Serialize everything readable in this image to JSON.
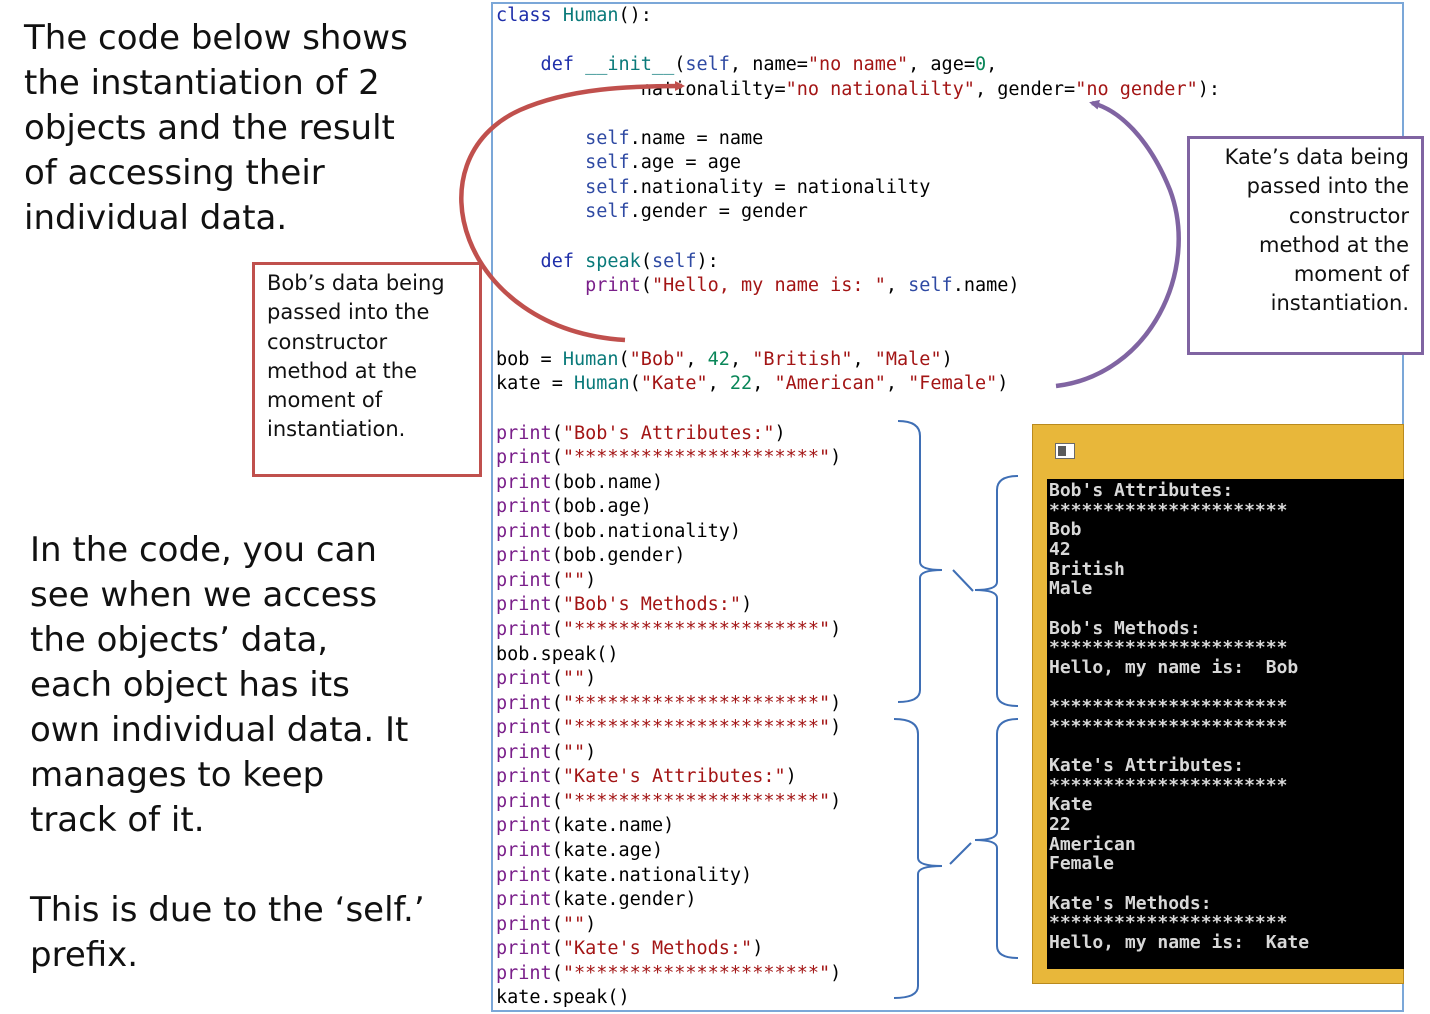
{
  "intro_text": [
    "The code below shows",
    "the instantiation of 2",
    "objects and the result",
    "of accessing their",
    "individual data."
  ],
  "explain_text": [
    "In the code, you can",
    "see when we access",
    "the objects’ data,",
    "each object has its",
    "own individual data. It",
    "manages to keep",
    "track of it."
  ],
  "prefix_text": [
    "This is due to the ‘self.’",
    "prefix."
  ],
  "callouts": {
    "bob": [
      "Bob’s data being",
      "passed into the",
      "constructor",
      "method at the",
      "moment of",
      "instantiation."
    ],
    "kate": [
      "Kate’s data being",
      "passed into the",
      "constructor",
      "method at the",
      "moment of",
      "instantiation."
    ]
  },
  "code": [
    [
      [
        "kw",
        "class "
      ],
      [
        "fn",
        "Human"
      ],
      [
        "pl",
        "():"
      ]
    ],
    [],
    [
      [
        "kw",
        "    def "
      ],
      [
        "fn",
        "__init__"
      ],
      [
        "pl",
        "("
      ],
      [
        "sf",
        "self"
      ],
      [
        "pl",
        ", name="
      ],
      [
        "st",
        "\"no name\""
      ],
      [
        "pl",
        ", age="
      ],
      [
        "nu",
        "0"
      ],
      [
        "pl",
        ","
      ]
    ],
    [
      [
        "pl",
        "             nationalilty="
      ],
      [
        "st",
        "\"no nationalilty\""
      ],
      [
        "pl",
        ", gender="
      ],
      [
        "st",
        "\"no gender\""
      ],
      [
        "pl",
        "):"
      ]
    ],
    [],
    [
      [
        "sf",
        "        self"
      ],
      [
        "pl",
        ".name = name"
      ]
    ],
    [
      [
        "sf",
        "        self"
      ],
      [
        "pl",
        ".age = age"
      ]
    ],
    [
      [
        "sf",
        "        self"
      ],
      [
        "pl",
        ".nationality = nationalilty"
      ]
    ],
    [
      [
        "sf",
        "        self"
      ],
      [
        "pl",
        ".gender = gender"
      ]
    ],
    [],
    [
      [
        "kw",
        "    def "
      ],
      [
        "fn",
        "speak"
      ],
      [
        "pl",
        "("
      ],
      [
        "sf",
        "self"
      ],
      [
        "pl",
        "):"
      ]
    ],
    [
      [
        "bi",
        "        print"
      ],
      [
        "pl",
        "("
      ],
      [
        "st",
        "\"Hello, my name is: \""
      ],
      [
        "pl",
        ", "
      ],
      [
        "sf",
        "self"
      ],
      [
        "pl",
        ".name)"
      ]
    ],
    [],
    [],
    [
      [
        "pl",
        "bob = "
      ],
      [
        "fn",
        "Human"
      ],
      [
        "pl",
        "("
      ],
      [
        "st",
        "\"Bob\""
      ],
      [
        "pl",
        ", "
      ],
      [
        "nu",
        "42"
      ],
      [
        "pl",
        ", "
      ],
      [
        "st",
        "\"British\""
      ],
      [
        "pl",
        ", "
      ],
      [
        "st",
        "\"Male\""
      ],
      [
        "pl",
        ")"
      ]
    ],
    [
      [
        "pl",
        "kate = "
      ],
      [
        "fn",
        "Human"
      ],
      [
        "pl",
        "("
      ],
      [
        "st",
        "\"Kate\""
      ],
      [
        "pl",
        ", "
      ],
      [
        "nu",
        "22"
      ],
      [
        "pl",
        ", "
      ],
      [
        "st",
        "\"American\""
      ],
      [
        "pl",
        ", "
      ],
      [
        "st",
        "\"Female\""
      ],
      [
        "pl",
        ")"
      ]
    ],
    [],
    [
      [
        "bi",
        "print"
      ],
      [
        "pl",
        "("
      ],
      [
        "st",
        "\"Bob's Attributes:\""
      ],
      [
        "pl",
        ")"
      ]
    ],
    [
      [
        "bi",
        "print"
      ],
      [
        "pl",
        "("
      ],
      [
        "st",
        "\"**********************\""
      ],
      [
        "pl",
        ")"
      ]
    ],
    [
      [
        "bi",
        "print"
      ],
      [
        "pl",
        "(bob.name)"
      ]
    ],
    [
      [
        "bi",
        "print"
      ],
      [
        "pl",
        "(bob.age)"
      ]
    ],
    [
      [
        "bi",
        "print"
      ],
      [
        "pl",
        "(bob.nationality)"
      ]
    ],
    [
      [
        "bi",
        "print"
      ],
      [
        "pl",
        "(bob.gender)"
      ]
    ],
    [
      [
        "bi",
        "print"
      ],
      [
        "pl",
        "("
      ],
      [
        "st",
        "\"\""
      ],
      [
        "pl",
        ")"
      ]
    ],
    [
      [
        "bi",
        "print"
      ],
      [
        "pl",
        "("
      ],
      [
        "st",
        "\"Bob's Methods:\""
      ],
      [
        "pl",
        ")"
      ]
    ],
    [
      [
        "bi",
        "print"
      ],
      [
        "pl",
        "("
      ],
      [
        "st",
        "\"**********************\""
      ],
      [
        "pl",
        ")"
      ]
    ],
    [
      [
        "pl",
        "bob.speak()"
      ]
    ],
    [
      [
        "bi",
        "print"
      ],
      [
        "pl",
        "("
      ],
      [
        "st",
        "\"\""
      ],
      [
        "pl",
        ")"
      ]
    ],
    [
      [
        "bi",
        "print"
      ],
      [
        "pl",
        "("
      ],
      [
        "st",
        "\"**********************\""
      ],
      [
        "pl",
        ")"
      ]
    ],
    [
      [
        "bi",
        "print"
      ],
      [
        "pl",
        "("
      ],
      [
        "st",
        "\"**********************\""
      ],
      [
        "pl",
        ")"
      ]
    ],
    [
      [
        "bi",
        "print"
      ],
      [
        "pl",
        "("
      ],
      [
        "st",
        "\"\""
      ],
      [
        "pl",
        ")"
      ]
    ],
    [
      [
        "bi",
        "print"
      ],
      [
        "pl",
        "("
      ],
      [
        "st",
        "\"Kate's Attributes:\""
      ],
      [
        "pl",
        ")"
      ]
    ],
    [
      [
        "bi",
        "print"
      ],
      [
        "pl",
        "("
      ],
      [
        "st",
        "\"**********************\""
      ],
      [
        "pl",
        ")"
      ]
    ],
    [
      [
        "bi",
        "print"
      ],
      [
        "pl",
        "(kate.name)"
      ]
    ],
    [
      [
        "bi",
        "print"
      ],
      [
        "pl",
        "(kate.age)"
      ]
    ],
    [
      [
        "bi",
        "print"
      ],
      [
        "pl",
        "(kate.nationality)"
      ]
    ],
    [
      [
        "bi",
        "print"
      ],
      [
        "pl",
        "(kate.gender)"
      ]
    ],
    [
      [
        "bi",
        "print"
      ],
      [
        "pl",
        "("
      ],
      [
        "st",
        "\"\""
      ],
      [
        "pl",
        ")"
      ]
    ],
    [
      [
        "bi",
        "print"
      ],
      [
        "pl",
        "("
      ],
      [
        "st",
        "\"Kate's Methods:\""
      ],
      [
        "pl",
        ")"
      ]
    ],
    [
      [
        "bi",
        "print"
      ],
      [
        "pl",
        "("
      ],
      [
        "st",
        "\"**********************\""
      ],
      [
        "pl",
        ")"
      ]
    ],
    [
      [
        "pl",
        "kate.speak()"
      ]
    ]
  ],
  "console_output": [
    "Bob's Attributes:",
    "**********************",
    "Bob",
    "42",
    "British",
    "Male",
    "",
    "Bob's Methods:",
    "**********************",
    "Hello, my name is:  Bob",
    "",
    "**********************",
    "**********************",
    "",
    "Kate's Attributes:",
    "**********************",
    "Kate",
    "22",
    "American",
    "Female",
    "",
    "Kate's Methods:",
    "**********************",
    "Hello, my name is:  Kate"
  ],
  "colors": {
    "bob_arrow": "#c0504d",
    "kate_arrow": "#8064a2",
    "bracket": "#3f6fb5",
    "panel_border": "#7ba7d8",
    "console_frame": "#e8b73a"
  }
}
